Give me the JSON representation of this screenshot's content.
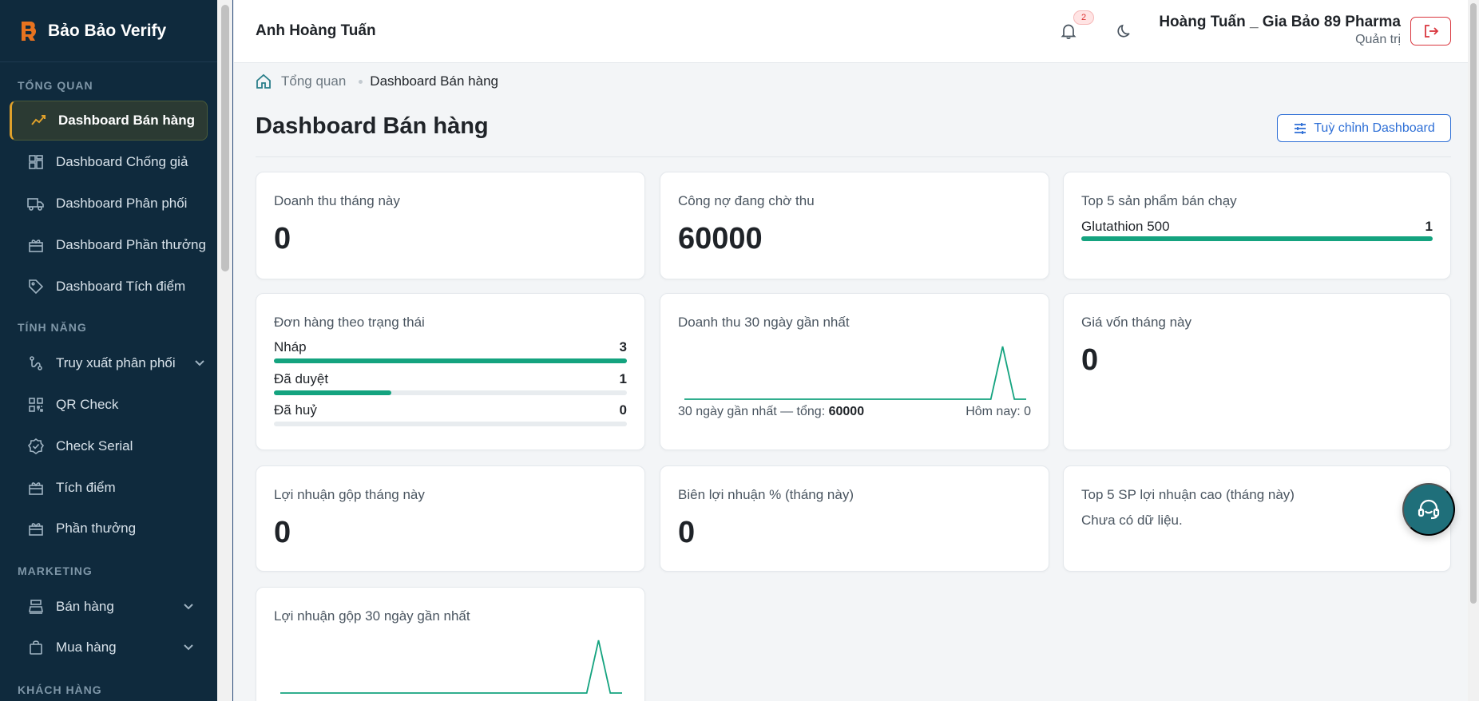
{
  "brand": {
    "name": "Bảo Bảo Verify"
  },
  "sidebar": {
    "sections": [
      {
        "label": "TỔNG QUAN"
      },
      {
        "label": "TÍNH NĂNG"
      },
      {
        "label": "MARKETING"
      },
      {
        "label": "KHÁCH HÀNG"
      }
    ],
    "items": [
      {
        "label": "Dashboard Bán hàng",
        "icon": "trend-icon",
        "active": true
      },
      {
        "label": "Dashboard Chống giả",
        "icon": "grid-icon"
      },
      {
        "label": "Dashboard Phân phối",
        "icon": "truck-icon"
      },
      {
        "label": "Dashboard Phần thưởng",
        "icon": "gift-icon"
      },
      {
        "label": "Dashboard Tích điểm",
        "icon": "tag-icon"
      },
      {
        "label": "Truy xuất phân phối",
        "icon": "route-icon",
        "expandable": true
      },
      {
        "label": "QR Check",
        "icon": "qr-icon"
      },
      {
        "label": "Check Serial",
        "icon": "badge-check-icon"
      },
      {
        "label": "Tích điểm",
        "icon": "gift-icon"
      },
      {
        "label": "Phần thưởng",
        "icon": "gift-icon"
      },
      {
        "label": "Bán hàng",
        "icon": "cash-register-icon",
        "expandable": true
      },
      {
        "label": "Mua hàng",
        "icon": "bag-icon",
        "expandable": true
      }
    ]
  },
  "topbar": {
    "title": "Anh Hoàng Tuấn",
    "notification_count": "2",
    "user_name": "Hoàng Tuấn _ Gia Bảo 89 Pharma",
    "user_role": "Quản trị"
  },
  "breadcrumb": {
    "home": "Tổng quan",
    "current": "Dashboard Bán hàng"
  },
  "page": {
    "title": "Dashboard Bán hàng",
    "customize_label": "Tuỳ chỉnh Dashboard"
  },
  "cards": {
    "revenue_month": {
      "title": "Doanh thu tháng này",
      "value": "0"
    },
    "receivables": {
      "title": "Công nợ đang chờ thu",
      "value": "60000"
    },
    "top_products": {
      "title": "Top 5 sản phẩm bán chạy",
      "items": [
        {
          "name": "Glutathion 500",
          "value": "1",
          "fraction": 1.0
        }
      ]
    },
    "orders_by_status": {
      "title": "Đơn hàng theo trạng thái",
      "rows": [
        {
          "label": "Nháp",
          "value": "3",
          "fraction": 1.0
        },
        {
          "label": "Đã duyệt",
          "value": "1",
          "fraction": 0.3333
        },
        {
          "label": "Đã huỷ",
          "value": "0",
          "fraction": 0.0
        }
      ]
    },
    "revenue_30d": {
      "title": "Doanh thu 30 ngày gần nhất",
      "footer_left": "30 ngày gần nhất — tổng:",
      "total": "60000",
      "footer_right": "Hôm nay: 0"
    },
    "cogs_month": {
      "title": "Giá vốn tháng này",
      "value": "0"
    },
    "gross_profit_month": {
      "title": "Lợi nhuận gộp tháng này",
      "value": "0"
    },
    "margin_month": {
      "title": "Biên lợi nhuận % (tháng này)",
      "value": "0"
    },
    "top_profit": {
      "title": "Top 5 SP lợi nhuận cao (tháng này)",
      "empty": "Chưa có dữ liệu."
    },
    "gross_profit_30d": {
      "title": "Lợi nhuận gộp 30 ngày gần nhất"
    }
  },
  "chart_data": [
    {
      "type": "line",
      "x": [
        1,
        2,
        3,
        4,
        5,
        6,
        7,
        8,
        9,
        10,
        11,
        12,
        13,
        14,
        15,
        16,
        17,
        18,
        19,
        20,
        21,
        22,
        23,
        24,
        25,
        26,
        27,
        28,
        29,
        30
      ],
      "series": [
        {
          "values": [
            0,
            0,
            0,
            0,
            0,
            0,
            0,
            0,
            0,
            0,
            0,
            0,
            0,
            0,
            0,
            0,
            0,
            0,
            0,
            0,
            0,
            0,
            0,
            0,
            0,
            0,
            0,
            60000,
            0,
            0
          ]
        }
      ],
      "title": "Doanh thu 30 ngày gần nhất",
      "color": "#14a37f"
    },
    {
      "type": "line",
      "x": [
        1,
        2,
        3,
        4,
        5,
        6,
        7,
        8,
        9,
        10,
        11,
        12,
        13,
        14,
        15,
        16,
        17,
        18,
        19,
        20,
        21,
        22,
        23,
        24,
        25,
        26,
        27,
        28,
        29,
        30
      ],
      "series": [
        {
          "values": [
            0,
            0,
            0,
            0,
            0,
            0,
            0,
            0,
            0,
            0,
            0,
            0,
            0,
            0,
            0,
            0,
            0,
            0,
            0,
            0,
            0,
            0,
            0,
            0,
            0,
            0,
            0,
            1,
            0,
            0
          ]
        }
      ],
      "title": "Lợi nhuận gộp 30 ngày gần nhất",
      "color": "#14a37f"
    }
  ],
  "colors": {
    "accent": "#14a37f",
    "sidebar_bg": "#0f2a3d",
    "active_highlight": "#e0a12b",
    "primary": "#2e6fd6",
    "danger": "#d9363e"
  }
}
